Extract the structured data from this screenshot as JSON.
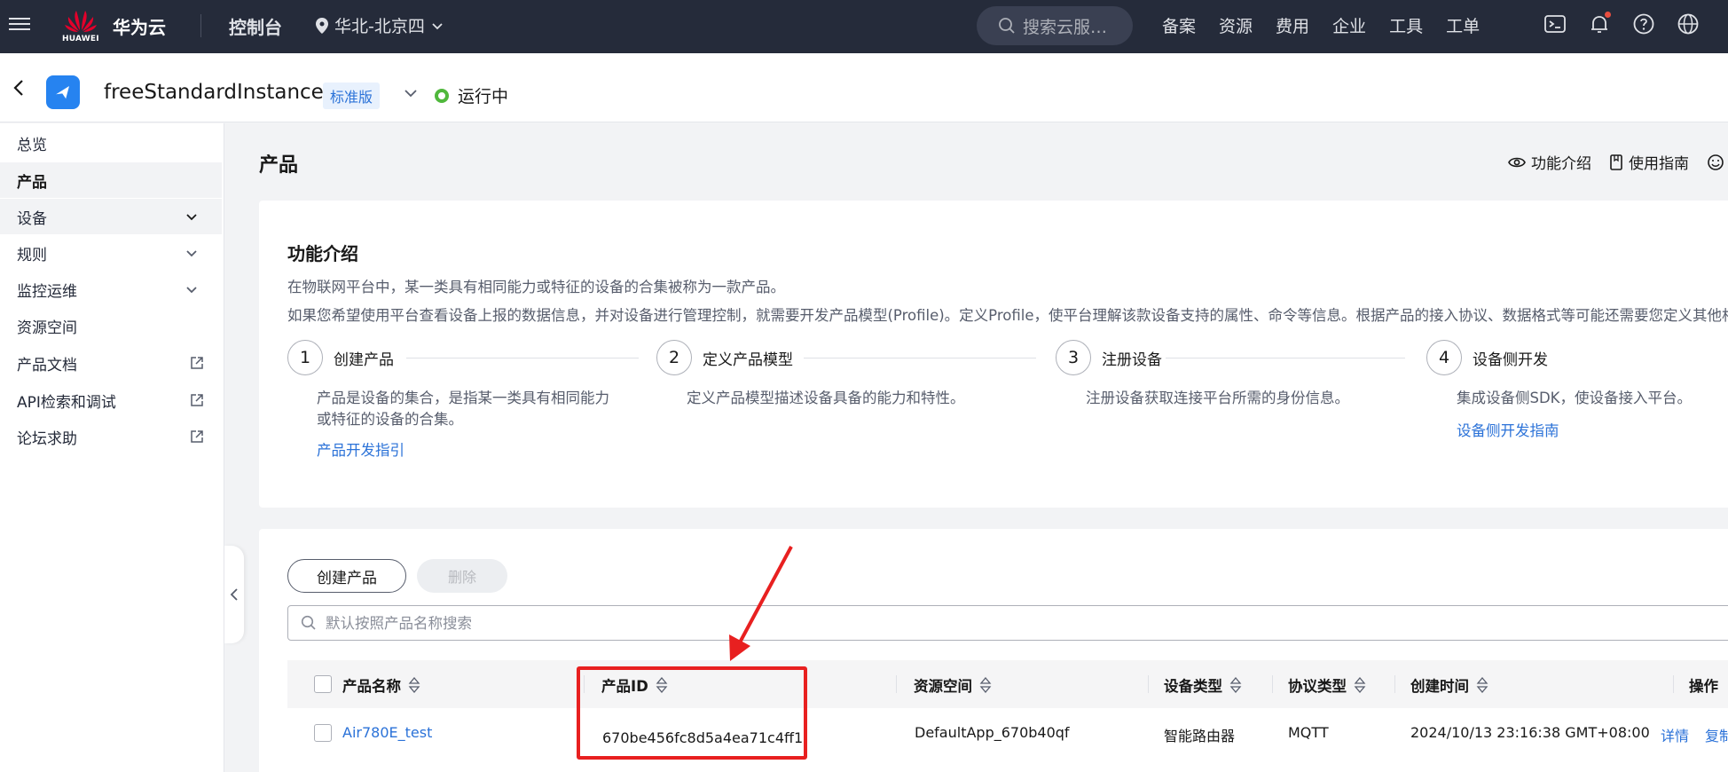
{
  "topbar": {
    "logo_text": "HUAWEI",
    "brand": "华为云",
    "console": "控制台",
    "region": "华北-北京四",
    "search_placeholder": "搜索云服…",
    "links": [
      "备案",
      "资源",
      "费用",
      "企业",
      "工具",
      "工单"
    ]
  },
  "instance": {
    "name": "freeStandardInstance",
    "edition": "标准版",
    "status": "运行中",
    "status_color": "#50b83c"
  },
  "sidebar": {
    "items": [
      {
        "label": "总览"
      },
      {
        "label": "产品"
      },
      {
        "label": "设备"
      },
      {
        "label": "规则"
      },
      {
        "label": "监控运维"
      },
      {
        "label": "资源空间"
      },
      {
        "label": "产品文档"
      },
      {
        "label": "API检索和调试"
      },
      {
        "label": "论坛求助"
      }
    ]
  },
  "page": {
    "title": "产品",
    "actions": [
      "功能介绍",
      "使用指南"
    ]
  },
  "intro": {
    "title": "功能介绍",
    "line1": "在物联网平台中，某一类具有相同能力或特征的设备的合集被称为一款产品。",
    "line2": "如果您希望使用平台查看设备上报的数据信息，并对设备进行管理控制，就需要开发产品模型(Profile)。定义Profile，使平台理解该款设备支持的属性、命令等信息。根据产品的接入协议、数据格式等可能还需要您定义其他相",
    "steps": [
      {
        "num": "1",
        "title": "创建产品",
        "desc1": "产品是设备的集合，是指某一类具有相同能力",
        "desc2": "或特征的设备的合集。",
        "link": "产品开发指引"
      },
      {
        "num": "2",
        "title": "定义产品模型",
        "desc1": "定义产品模型描述设备具备的能力和特性。"
      },
      {
        "num": "3",
        "title": "注册设备",
        "desc1": "注册设备获取连接平台所需的身份信息。"
      },
      {
        "num": "4",
        "title": "设备侧开发",
        "desc1": "集成设备侧SDK，使设备接入平台。",
        "link": "设备侧开发指南"
      }
    ]
  },
  "list": {
    "create_label": "创建产品",
    "delete_label": "删除",
    "search_placeholder": "默认按照产品名称搜索",
    "columns": [
      "产品名称",
      "产品ID",
      "资源空间",
      "设备类型",
      "协议类型",
      "创建时间",
      "操作"
    ],
    "rows": [
      {
        "name": "Air780E_test",
        "id": "670be456fc8d5a4ea71c4ff1",
        "space": "DefaultApp_670b40qf",
        "device_type": "智能路由器",
        "protocol": "MQTT",
        "created": "2024/10/13 23:16:38 GMT+08:00",
        "op_detail": "详情",
        "op_copy": "复制"
      }
    ]
  },
  "colors": {
    "accent": "#2b72d8",
    "topbar_bg": "#252b3a",
    "annotation": "#e82020"
  }
}
